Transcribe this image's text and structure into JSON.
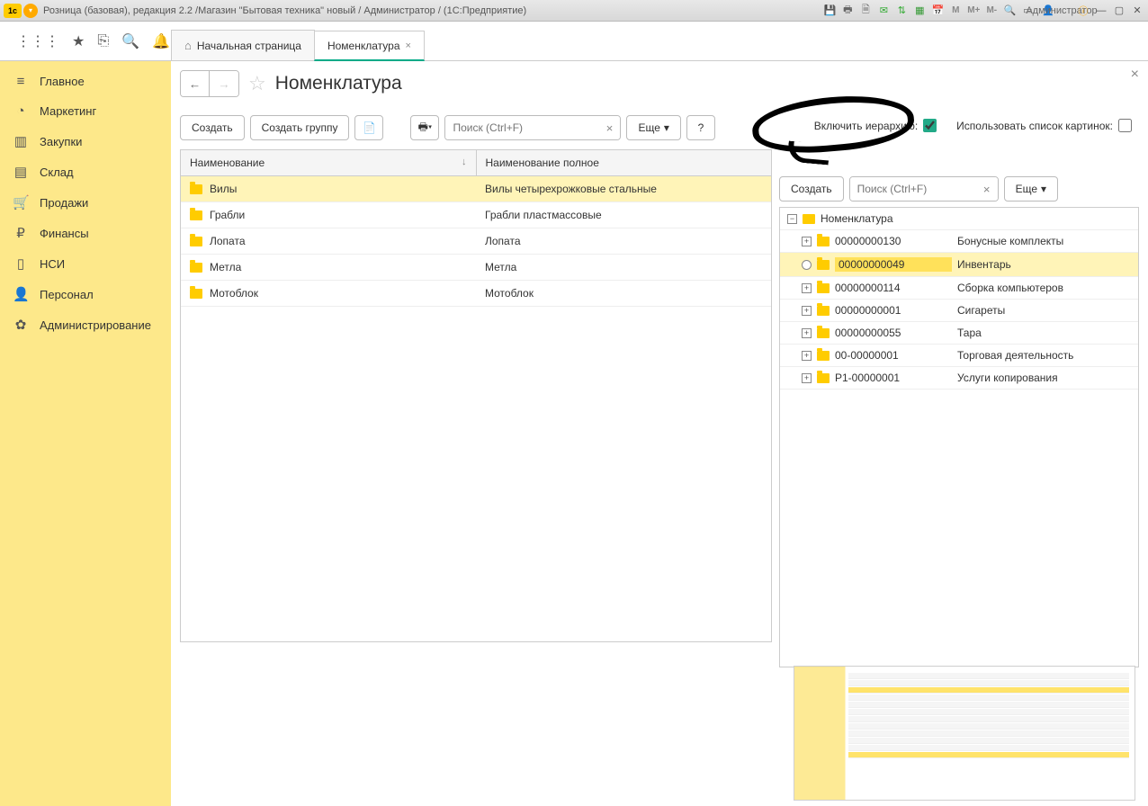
{
  "titlebar": {
    "title": "Розница (базовая), редакция 2.2 /Магазин \"Бытовая техника\" новый / Администратор /   (1С:Предприятие)",
    "user": "Администратор"
  },
  "tabs": {
    "home": "Начальная страница",
    "active": "Номенклатура"
  },
  "sidebar": [
    {
      "icon": "≡",
      "label": "Главное"
    },
    {
      "icon": "◔",
      "label": "Маркетинг"
    },
    {
      "icon": "▥",
      "label": "Закупки"
    },
    {
      "icon": "▤",
      "label": "Склад"
    },
    {
      "icon": "🛒",
      "label": "Продажи"
    },
    {
      "icon": "₽",
      "label": "Финансы"
    },
    {
      "icon": "▯",
      "label": "НСИ"
    },
    {
      "icon": "👤",
      "label": "Персонал"
    },
    {
      "icon": "✿",
      "label": "Администрирование"
    }
  ],
  "page": {
    "title": "Номенклатура",
    "btn_create": "Создать",
    "btn_group": "Создать группу",
    "btn_more": "Еще",
    "search_ph": "Поиск (Ctrl+F)",
    "chk_hierarchy": "Включить иерархию:",
    "chk_images": "Использовать список картинок:"
  },
  "table": {
    "col1": "Наименование",
    "col2": "Наименование полное",
    "rows": [
      {
        "name": "Вилы",
        "full": "Вилы четырехрожковые стальные",
        "sel": true
      },
      {
        "name": "Грабли",
        "full": "Грабли пластмассовые"
      },
      {
        "name": "Лопата",
        "full": "Лопата"
      },
      {
        "name": "Метла",
        "full": "Метла"
      },
      {
        "name": "Мотоблок",
        "full": "Мотоблок"
      }
    ]
  },
  "tree": {
    "root": "Номенклатура",
    "nodes": [
      {
        "code": "00000000130",
        "name": "Бонусные комплекты"
      },
      {
        "code": "00000000049",
        "name": "Инвентарь",
        "sel": true
      },
      {
        "code": "00000000114",
        "name": "Сборка компьютеров"
      },
      {
        "code": "00000000001",
        "name": "Сигареты"
      },
      {
        "code": "00000000055",
        "name": "Тара"
      },
      {
        "code": "00-00000001",
        "name": "Торговая деятельность"
      },
      {
        "code": "Р1-00000001",
        "name": "Услуги копирования"
      }
    ]
  }
}
